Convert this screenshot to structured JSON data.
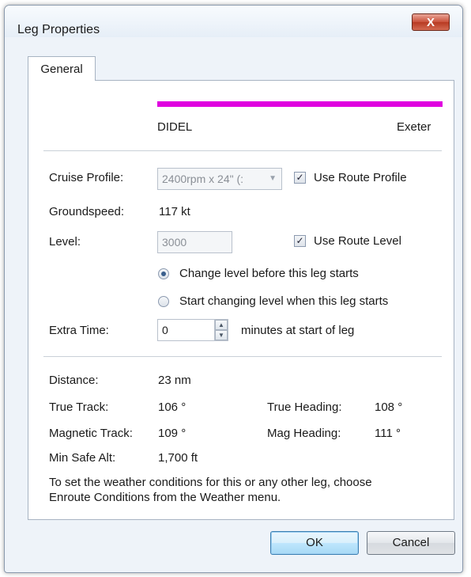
{
  "window": {
    "title": "Leg Properties",
    "close_glyph": "X"
  },
  "tabs": [
    {
      "label": "General"
    }
  ],
  "route": {
    "from": "DIDEL",
    "to": "Exeter",
    "line_color": "#e000e0"
  },
  "cruise_profile": {
    "label": "Cruise Profile:",
    "value": "2400rpm x 24\" (:",
    "use_route_label": "Use Route Profile",
    "use_route_checked": true
  },
  "groundspeed": {
    "label": "Groundspeed:",
    "value": "117 kt"
  },
  "level": {
    "label": "Level:",
    "value": "3000",
    "use_route_label": "Use Route Level",
    "use_route_checked": true,
    "options": [
      {
        "label": "Change level before this leg starts",
        "selected": true
      },
      {
        "label": "Start changing level when this leg starts",
        "selected": false
      }
    ]
  },
  "extra_time": {
    "label": "Extra Time:",
    "value": "0",
    "suffix": "minutes at start of leg"
  },
  "stats": {
    "distance_label": "Distance:",
    "distance_value": "23 nm",
    "true_track_label": "True Track:",
    "true_track_value": "106 °",
    "true_heading_label": "True Heading:",
    "true_heading_value": "108 °",
    "mag_track_label": "Magnetic Track:",
    "mag_track_value": "109 °",
    "mag_heading_label": "Mag Heading:",
    "mag_heading_value": "111 °",
    "min_safe_alt_label": "Min Safe Alt:",
    "min_safe_alt_value": "1,700 ft"
  },
  "info": {
    "line1": "To set the weather conditions for this or any other leg, choose",
    "line2": "Enroute Conditions from the Weather menu."
  },
  "buttons": {
    "ok": "OK",
    "cancel": "Cancel"
  }
}
